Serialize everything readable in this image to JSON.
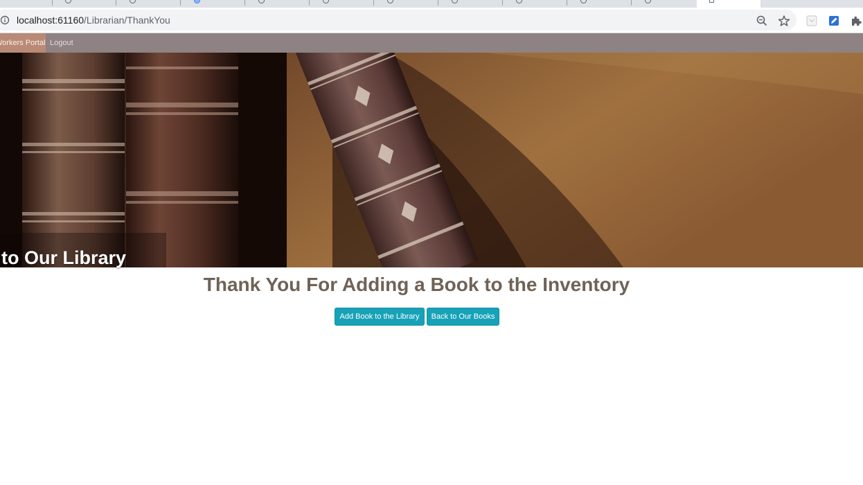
{
  "browser": {
    "url_host": "localhost:61160",
    "url_path": "/Librarian/ThankYou",
    "icons": [
      "info-icon",
      "zoom-out-icon",
      "bookmark-star-icon",
      "pocket-extension-icon",
      "edit-extension-icon",
      "extensions-puzzle-icon"
    ]
  },
  "nav": {
    "portal_label": "Workers Portal",
    "logout_label": "Logout"
  },
  "hero": {
    "title": "to Our Library",
    "image": "old-leather-books-on-wooden-shelf"
  },
  "main": {
    "heading": "Thank You For Adding a Book to the Inventory",
    "add_button": "Add Book to the Library",
    "back_button": "Back to Our Books"
  },
  "colors": {
    "navbar": "#8e8282",
    "nav_active": "#b98a76",
    "heading": "#6f6256",
    "button": "#17a2b8"
  }
}
